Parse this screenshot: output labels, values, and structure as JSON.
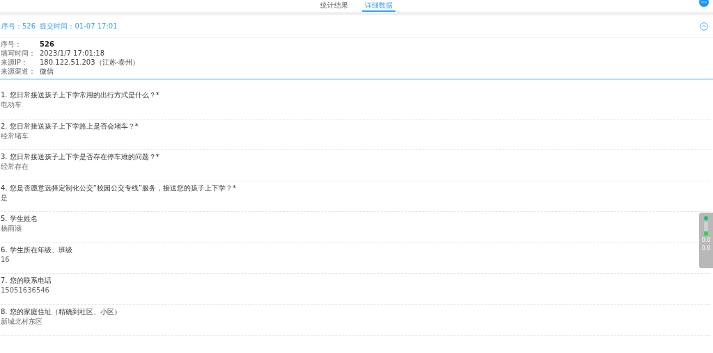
{
  "tabs": [
    {
      "label": "统计结果",
      "selected": false
    },
    {
      "label": "详细数据",
      "selected": true
    }
  ],
  "record_header": {
    "text": "序号：526  提交时间：01-07 17:01",
    "expanded": true
  },
  "info": [
    {
      "label": "序号：",
      "value": "526",
      "bold": true
    },
    {
      "label": "填写时间：",
      "value": "2023/1/7 17:01:18",
      "bold": false
    },
    {
      "label": "来源IP：",
      "value": "180.122.51.203（江苏-泰州）",
      "bold": false
    },
    {
      "label": "来源渠道：",
      "value": "微信",
      "bold": false
    }
  ],
  "questions": [
    {
      "question": "1. 您日常接送孩子上下学常用的出行方式是什么？*",
      "answer": "电动车"
    },
    {
      "question": "2. 您日常接送孩子上下学路上是否会堵车？*",
      "answer": "经常堵车"
    },
    {
      "question": "3. 您日常接送孩子上下学是否存在停车难的问题？*",
      "answer": "经常存在"
    },
    {
      "question": "4. 您是否愿意选择定制化公交“校园公交专线”服务，接送您的孩子上下学？*",
      "answer": "是"
    },
    {
      "question": "5. 学生姓名",
      "answer": "杨雨涵"
    },
    {
      "question": "6. 学生所在年级、班级",
      "answer": "16"
    },
    {
      "question": "7. 您的联系电话",
      "answer": "15051636546"
    },
    {
      "question": "8. 您的家庭住址（精确到社区、小区）",
      "answer": "新城北村东区"
    }
  ],
  "speed_widget": {
    "readings": [
      "0.0",
      "0.0"
    ]
  }
}
